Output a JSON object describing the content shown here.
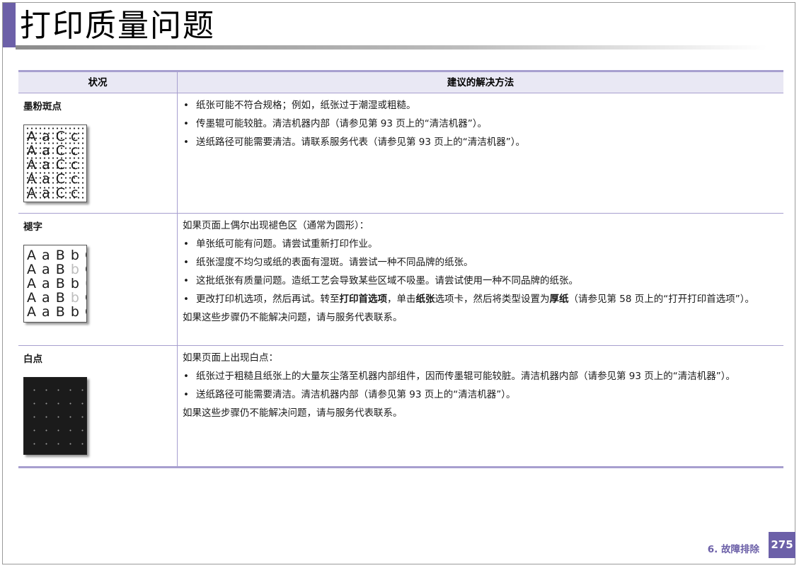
{
  "page": {
    "title": "打印质量问题",
    "footer_section": "6.  故障排除",
    "page_number": "275"
  },
  "table": {
    "header_issue": "状况",
    "header_solution": "建议的解决方法",
    "rows": [
      {
        "issue": "墨粉斑点",
        "sample_letters": [
          "A a C c",
          "A a C c",
          "A a C c",
          "A a C c",
          "A a C c"
        ],
        "bullets": [
          "纸张可能不符合规格；例如，纸张过于潮湿或粗糙。",
          "传墨辊可能较脏。清洁机器内部（请参见第 93 页上的“清洁机器”）。",
          "送纸路径可能需要清洁。请联系服务代表（请参见第 93 页上的“清洁机器”）。"
        ]
      },
      {
        "issue": "褪字",
        "sample_letters": [
          "A a B b C",
          "A a B b C",
          "A a B b C",
          "A a B b C",
          "A a B b C"
        ],
        "intro": "如果页面上偶尔出现褪色区（通常为圆形）：",
        "bullets": [
          "单张纸可能有问题。请尝试重新打印作业。",
          "纸张湿度不均匀或纸的表面有湿斑。请尝试一种不同品牌的纸张。",
          "这批纸张有质量问题。造纸工艺会导致某些区域不吸墨。请尝试使用一种不同品牌的纸张。"
        ],
        "bullet4_a": "更改打印机选项，然后再试。转至",
        "bullet4_b": "打印首选项",
        "bullet4_c": "，单击",
        "bullet4_d": "纸张",
        "bullet4_e": "选项卡，然后将类型设置为",
        "bullet4_f": "厚纸",
        "bullet4_g": "（请参见第 58 页上的“打开打印首选项”）。",
        "outro": "如果这些步骤仍不能解决问题，请与服务代表联系。"
      },
      {
        "issue": "白点",
        "intro": "如果页面上出现白点：",
        "bullets": [
          "纸张过于粗糙且纸张上的大量灰尘落至机器内部组件，因而传墨辊可能较脏。清洁机器内部（请参见第 93 页上的“清洁机器”）。",
          "送纸路径可能需要清洁。清洁机器内部（请参见第 93 页上的“清洁机器”）。"
        ],
        "outro": "如果这些步骤仍不能解决问题，请与服务代表联系。"
      }
    ]
  },
  "colors": {
    "accent": "#6c60a8",
    "rule": "#a79fcf",
    "header_bg": "#e9e8f4"
  }
}
